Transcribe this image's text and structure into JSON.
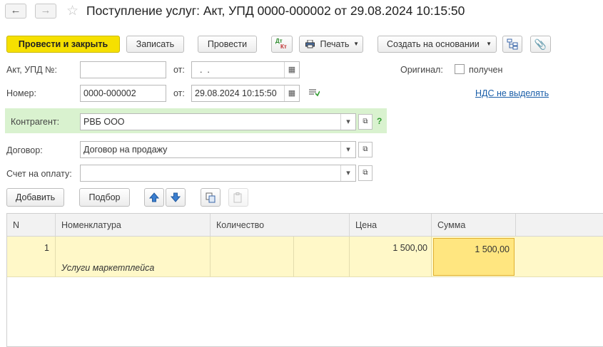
{
  "window": {
    "title": "Поступление услуг: Акт, УПД 0000-000002 от 29.08.2024 10:15:50",
    "back_icon": "←",
    "forward_icon": "→",
    "star_icon": "☆"
  },
  "toolbar": {
    "post_close_label": "Провести и закрыть",
    "save_label": "Записать",
    "post_label": "Провести",
    "dt_label": "Дт",
    "kt_label": "Кт",
    "print_label": "Печать",
    "create_based_label": "Создать на основании"
  },
  "form": {
    "act_label": "Акт, УПД №:",
    "act_value": "",
    "from_label": "от:",
    "act_date_value": "  .  .",
    "original_label": "Оригинал:",
    "received_label": "получен",
    "number_label": "Номер:",
    "number_value": "0000-000002",
    "date_label": "от:",
    "date_value": "29.08.2024 10:15:50",
    "vat_link": "НДС не выделять",
    "counterparty_label": "Контрагент:",
    "counterparty_value": "РВБ ООО",
    "help_icon": "?",
    "contract_label": "Договор:",
    "contract_value": "Договор на продажу",
    "invoice_label": "Счет на оплату:",
    "invoice_value": ""
  },
  "table_toolbar": {
    "add_label": "Добавить",
    "select_label": "Подбор"
  },
  "table": {
    "headers": [
      "N",
      "Номенклатура",
      "Количество",
      "Цена",
      "Сумма"
    ],
    "rows": [
      {
        "n": "1",
        "nomenclature": "",
        "content": "Услуги маркетплейса",
        "quantity": "",
        "price": "1 500,00",
        "sum": "1 500,00"
      }
    ]
  },
  "colors": {
    "primary_button": "#f6e000",
    "selected_row": "#fff8c8",
    "active_cell": "#ffe680",
    "counterparty_band": "#d9f2cf",
    "link": "#1a5ea8"
  }
}
